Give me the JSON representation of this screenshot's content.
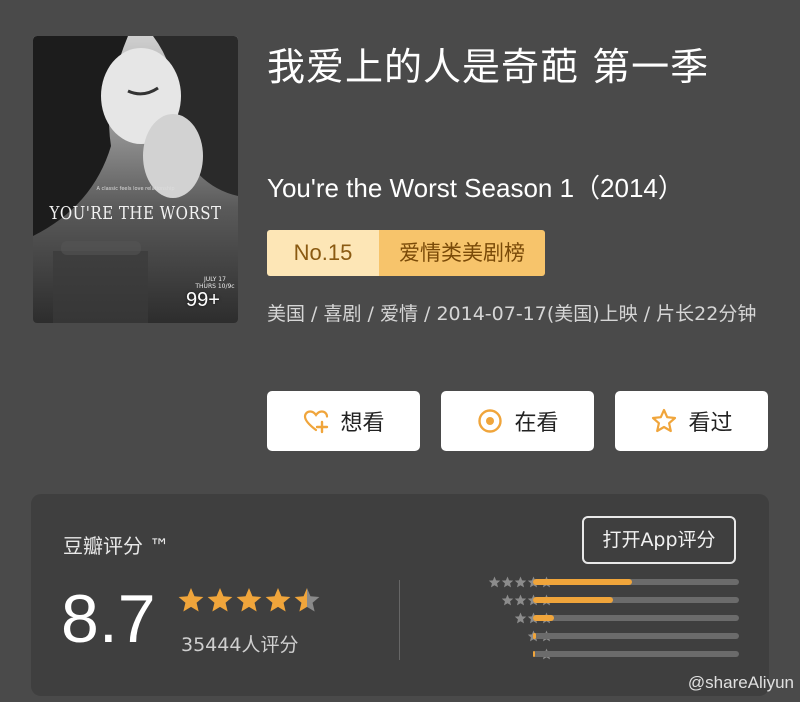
{
  "poster": {
    "tagline": "A classic feels love relationship",
    "title": "YOU'RE THE WORST",
    "release_line1": "JULY 17",
    "release_line2": "THURS 10/9c",
    "badge": "99+"
  },
  "show": {
    "title_cn": "我爱上的人是奇葩 第一季",
    "title_en": "You're the Worst Season 1（2014）",
    "rank_no": "No.15",
    "rank_list": "爱情类美剧榜",
    "meta": "美国 / 喜剧 / 爱情 / 2014-07-17(美国)上映 / 片长22分钟"
  },
  "actions": {
    "want": "想看",
    "watching": "在看",
    "watched": "看过"
  },
  "rating": {
    "label": "豆瓣评分 ™",
    "app_button": "打开App评分",
    "score": "8.7",
    "stars": 4.5,
    "votes": "35444人评分",
    "distribution": [
      {
        "stars": 5,
        "fraction": 0.48
      },
      {
        "stars": 4,
        "fraction": 0.39
      },
      {
        "stars": 3,
        "fraction": 0.1
      },
      {
        "stars": 2,
        "fraction": 0.015
      },
      {
        "stars": 1,
        "fraction": 0.01
      }
    ]
  },
  "watermark": "@shareAliyun",
  "colors": {
    "background": "#4a4a4a",
    "card": "#3f3f3f",
    "accent": "#f0a53b",
    "rank_light": "#fde6b6",
    "rank_dark": "#f7c46b"
  }
}
